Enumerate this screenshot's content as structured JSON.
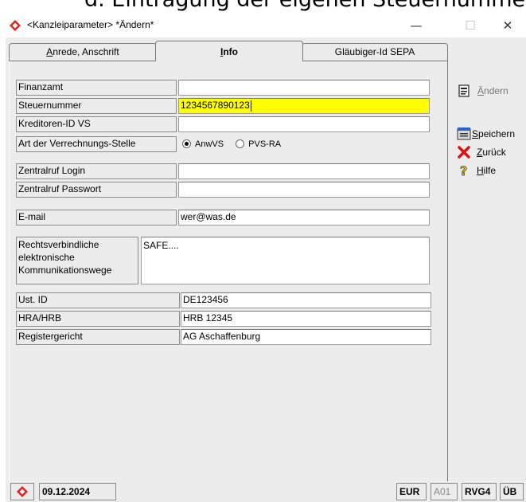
{
  "caption_text": "d.   Eintragung der eigenen Steuernummer",
  "window": {
    "title": "<Kanzleiparameter> *Ändern*",
    "minimize": "—",
    "maximize": "☐",
    "close": "✕"
  },
  "tabs": [
    {
      "label": "Anrede, Anschrift",
      "underline": "A",
      "rest": "nrede, Anschrift",
      "active": false
    },
    {
      "label": "Info",
      "underline": "I",
      "rest": "nfo",
      "active": true
    },
    {
      "label": "Gläubiger-Id SEPA",
      "active": false
    }
  ],
  "fields": {
    "finanzamt": {
      "label": "Finanzamt",
      "value": ""
    },
    "steuernummer": {
      "label": "Steuernummer",
      "value": "1234567890123"
    },
    "kreditoren": {
      "label": "Kreditoren-ID VS",
      "value": ""
    },
    "verrechnung": {
      "label": "Art der Verrechnungs-Stelle",
      "option1": "AnwVS",
      "option2": "PVS-RA",
      "selected": "AnwVS"
    },
    "zr_login": {
      "label": "Zentralruf Login",
      "value": ""
    },
    "zr_pass": {
      "label": "Zentralruf Passwort",
      "value": ""
    },
    "email": {
      "label": "E-mail",
      "value": "wer@was.de"
    },
    "kommunikation": {
      "label_line1": "Rechtsverbindliche",
      "label_line2": "elektronische",
      "label_line3": "Kommunikationswege",
      "value": "SAFE...."
    },
    "ust": {
      "label": "Ust. ID",
      "value": "DE123456"
    },
    "hra": {
      "label": "HRA/HRB",
      "value": "HRB 12345"
    },
    "register": {
      "label": "Registergericht",
      "value": "AG Aschaffenburg"
    }
  },
  "side": {
    "aendern": {
      "u": "Ä",
      "rest": "ndern",
      "enabled": false
    },
    "speichern": {
      "u": "S",
      "rest": "peichern"
    },
    "zurueck": {
      "u": "Z",
      "rest": "urück"
    },
    "hilfe": {
      "u": "H",
      "rest": "ilfe"
    }
  },
  "status": {
    "date": "09.12.2024",
    "currency": "EUR",
    "code": "A01",
    "rvg": "RVG4",
    "ub": "ÜB"
  },
  "colors": {
    "highlight": "#ffff00",
    "brand_red": "#e0241b",
    "cancel_red": "#e01010"
  }
}
